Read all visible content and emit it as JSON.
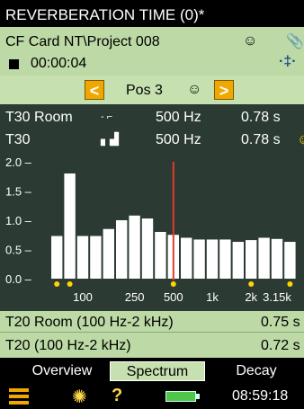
{
  "title": "REVERBERATION TIME (0)*",
  "info": {
    "project_path": "CF  Card NT\\Project 008",
    "elapsed_time": "00:00:04",
    "smiley_icon": "smiley-icon",
    "paperclip_icon": "paperclip-icon",
    "transducer_icon": "transducer-icon"
  },
  "position": {
    "prev_symbol": "<",
    "label": "Pos 3",
    "next_symbol": ">"
  },
  "results": {
    "row1": {
      "label": "T30 Room",
      "freq": "500 Hz",
      "value": "0.78 s"
    },
    "row2": {
      "label": "T30",
      "freq": "500 Hz",
      "value": "0.78 s"
    }
  },
  "chart_data": {
    "type": "bar",
    "ylim": [
      0,
      2.0
    ],
    "y_ticks": [
      "0.0",
      "0.5",
      "1.0",
      "1.5",
      "2.0"
    ],
    "y_tick_values": [
      0,
      0.5,
      1.0,
      1.5,
      2.0
    ],
    "x_tick_labels": [
      "100",
      "250",
      "500",
      "1k",
      "2k",
      "3.15k"
    ],
    "x_tick_bands": [
      2,
      6,
      9,
      12,
      15,
      17
    ],
    "values": [
      0.73,
      1.8,
      0.73,
      0.73,
      0.85,
      1.0,
      1.08,
      1.03,
      0.8,
      0.75,
      0.7,
      0.67,
      0.67,
      0.67,
      0.63,
      0.66,
      0.7,
      0.68,
      0.63
    ],
    "cursor_band": 9,
    "flag_bands": [
      0,
      1,
      9,
      15,
      18
    ],
    "colors": {
      "bar": "#ffffff",
      "cursor": "#e03a2a",
      "flag": "#ffd400",
      "background": "#2b3a33",
      "text": "#ffffff"
    }
  },
  "summary": {
    "row1": {
      "label": "T20 Room (100 Hz-2 kHz)",
      "value": "0.75 s"
    },
    "row2": {
      "label": "T20 (100 Hz-2 kHz)",
      "value": "0.72 s"
    }
  },
  "tabs": [
    {
      "label": "Overview",
      "active": false
    },
    {
      "label": "Spectrum",
      "active": true
    },
    {
      "label": "Decay",
      "active": false
    }
  ],
  "status": {
    "menu_icon": "menu-icon",
    "bulb_icon": "bulb-icon",
    "help_symbol": "?",
    "battery_icon": "battery-icon",
    "clock": "08:59:18"
  }
}
